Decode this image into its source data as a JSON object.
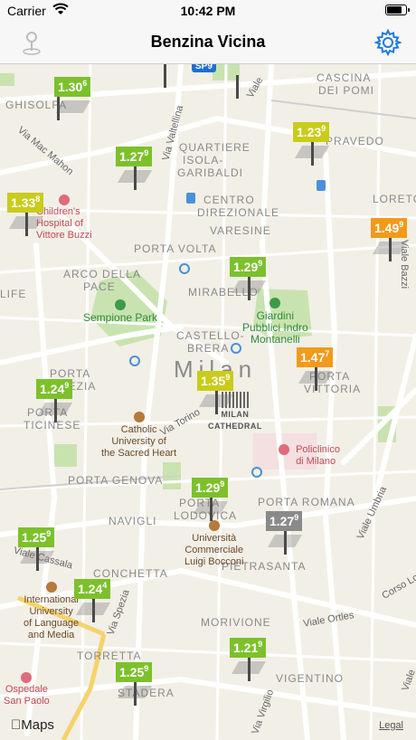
{
  "status_bar": {
    "carrier": "Carrier",
    "time": "10:42 PM"
  },
  "navbar": {
    "title": "Benzina Vicina",
    "left_icon": "location-pin-icon",
    "right_icon": "settings-gear-icon"
  },
  "colors": {
    "green": "#7cc12b",
    "yellow": "#c9cc1a",
    "orange": "#f29a1a",
    "gray": "#8a8a8a",
    "accent": "#1e7ae0"
  },
  "districts": [
    "GHISOLFA",
    "QUARTIERE",
    "ISOLA-",
    "GARIBALDI",
    "CENTRO",
    "DIREZIONALE",
    "PORTA VOLTA",
    "VARESINE",
    "ARCO DELLA",
    "PACE",
    "MIRABELLO",
    "LIFE",
    "CASTELLO-",
    "BRERA",
    "PORTA",
    "VENEZIA",
    "PORTA",
    "TICINESE",
    "PORTA GENOVA",
    "PORTA",
    "LODOVICA",
    "PORTA ROMANA",
    "NAVIGLI",
    "CONCHETTA",
    "PIETRASANTA",
    "MORIVIONE",
    "TORRETTA",
    "STADERA",
    "VIGENTINO",
    "CASCINA",
    "DEI POMI",
    "LORETO",
    "PORTA",
    "VITTORIA",
    "PRAVEDO"
  ],
  "city_name": "Milan",
  "pois": {
    "childrens_hospital": "Children's\nHospital of\nVittore Buzzi",
    "sempione_park": "Sempione Park",
    "giardini": "Giardini\nPubblici Indro\nMontanelli",
    "catholic_university": "Catholic\nUniversity of\nthe Sacred Heart",
    "milan_cathedral": "MILAN\nCATHEDRAL",
    "policlinico": "Policlinico\ndi Milano",
    "bocconi": "Università\nCommerciale\nLuigi Bocconi",
    "international_university": "International\nUniversity\nof Language\nand Media",
    "ospedale": "Ospedale\nSan Paolo"
  },
  "streets": [
    "Via Mac Mahon",
    "Via Valtellina",
    "Viale",
    "Via Torino",
    "Viale Cassala",
    "Viale Umbria",
    "Corso Lod",
    "Viale Ortles",
    "Via Spezia",
    "Via Virgilio",
    "Viale Bazzi",
    "Viale"
  ],
  "road_badges": [
    "SP9"
  ],
  "pins": [
    {
      "price": "1.30",
      "sup": "6",
      "color": "green"
    },
    {
      "price": "1.23",
      "sup": "9",
      "color": "yellow"
    },
    {
      "price": "1.27",
      "sup": "9",
      "color": "green"
    },
    {
      "price": "1.33",
      "sup": "8",
      "color": "yellow"
    },
    {
      "price": "1.49",
      "sup": "9",
      "color": "orange"
    },
    {
      "price": "1.29",
      "sup": "9",
      "color": "green"
    },
    {
      "price": "1.47",
      "sup": "7",
      "color": "orange"
    },
    {
      "price": "1.24",
      "sup": "9",
      "color": "green"
    },
    {
      "price": "1.35",
      "sup": "9",
      "color": "yellow"
    },
    {
      "price": "1.29",
      "sup": "9",
      "color": "green"
    },
    {
      "price": "1.27",
      "sup": "9",
      "color": "gray"
    },
    {
      "price": "1.25",
      "sup": "9",
      "color": "green"
    },
    {
      "price": "1.24",
      "sup": "4",
      "color": "green"
    },
    {
      "price": "1.21",
      "sup": "9",
      "color": "green"
    },
    {
      "price": "1.25",
      "sup": "9",
      "color": "green"
    }
  ],
  "footer": {
    "maps_label": "Maps",
    "legal_label": "Legal"
  }
}
